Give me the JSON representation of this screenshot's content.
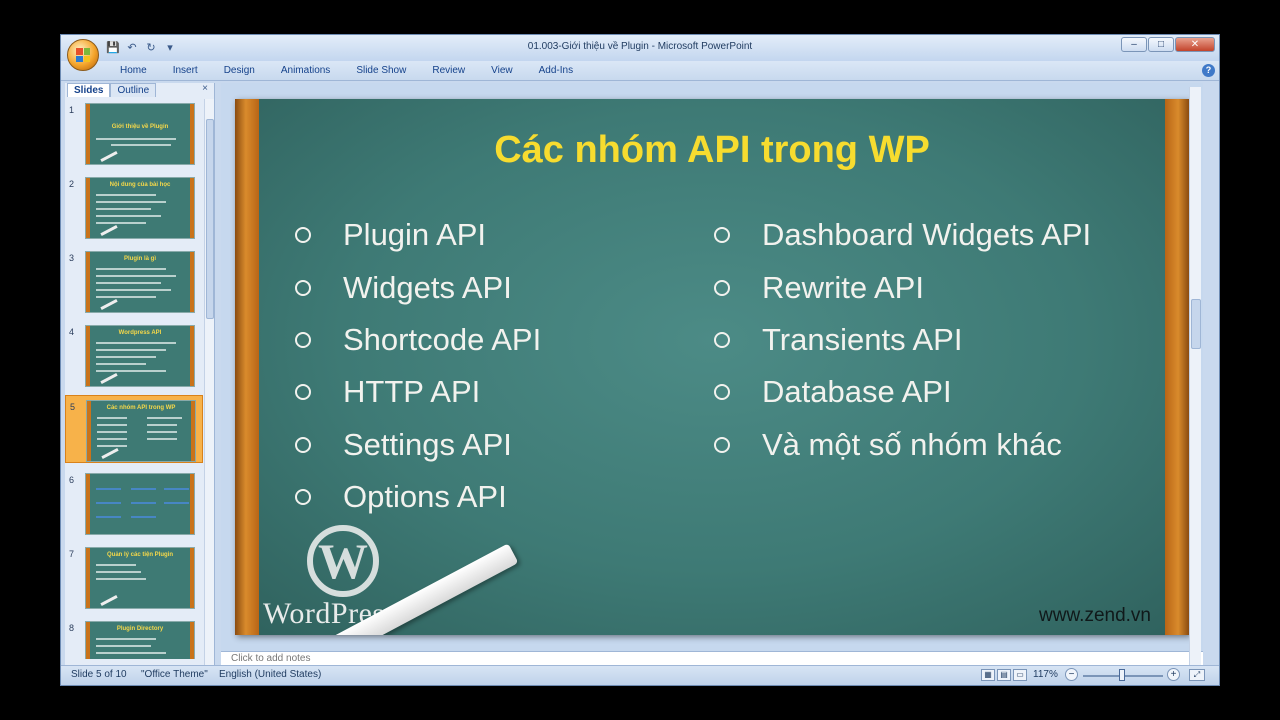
{
  "window": {
    "title": "01.003-Giới thiệu về Plugin - Microsoft PowerPoint",
    "minimize": "–",
    "maximize": "□",
    "close": "✕"
  },
  "qat": {
    "save": "💾",
    "undo": "↶",
    "redo": "↻",
    "customize": "▾"
  },
  "ribbon": {
    "tabs": [
      "Home",
      "Insert",
      "Design",
      "Animations",
      "Slide Show",
      "Review",
      "View",
      "Add-Ins"
    ],
    "help": "?"
  },
  "panel": {
    "tabs": [
      "Slides",
      "Outline"
    ],
    "close": "×",
    "thumbnails": [
      {
        "num": "1",
        "title": "Giới thiệu về Plugin"
      },
      {
        "num": "2",
        "title": "Nội dung của bài học"
      },
      {
        "num": "3",
        "title": "Plugin là gì"
      },
      {
        "num": "4",
        "title": "Wordpress API"
      },
      {
        "num": "5",
        "title": "Các nhóm API trong WP"
      },
      {
        "num": "6",
        "title": ""
      },
      {
        "num": "7",
        "title": "Quản lý các tiện Plugin"
      },
      {
        "num": "8",
        "title": "Plugin Directory"
      }
    ],
    "selected": "5"
  },
  "slide": {
    "title": "Các nhóm API trong WP",
    "left_items": [
      "Plugin API",
      "Widgets API",
      "Shortcode API",
      "HTTP API",
      "Settings API",
      "Options API"
    ],
    "right_items": [
      "Dashboard Widgets API",
      "Rewrite API",
      "Transients API",
      "Database API",
      "Và một số nhóm khác"
    ],
    "logo_letter": "W",
    "logo_text": "WordPress",
    "website": "www.zend.vn"
  },
  "notes": {
    "placeholder": "Click to add notes"
  },
  "status": {
    "slide": "Slide 5 of 10",
    "theme": "\"Office Theme\"",
    "language": "English (United States)",
    "zoom": "117%",
    "zoom_minus": "−",
    "zoom_plus": "+"
  },
  "colors": {
    "title": "#f7dc2f",
    "board": "#3e7a75",
    "frame": "#d98b2c",
    "selected_thumb": "#f7b24a"
  }
}
